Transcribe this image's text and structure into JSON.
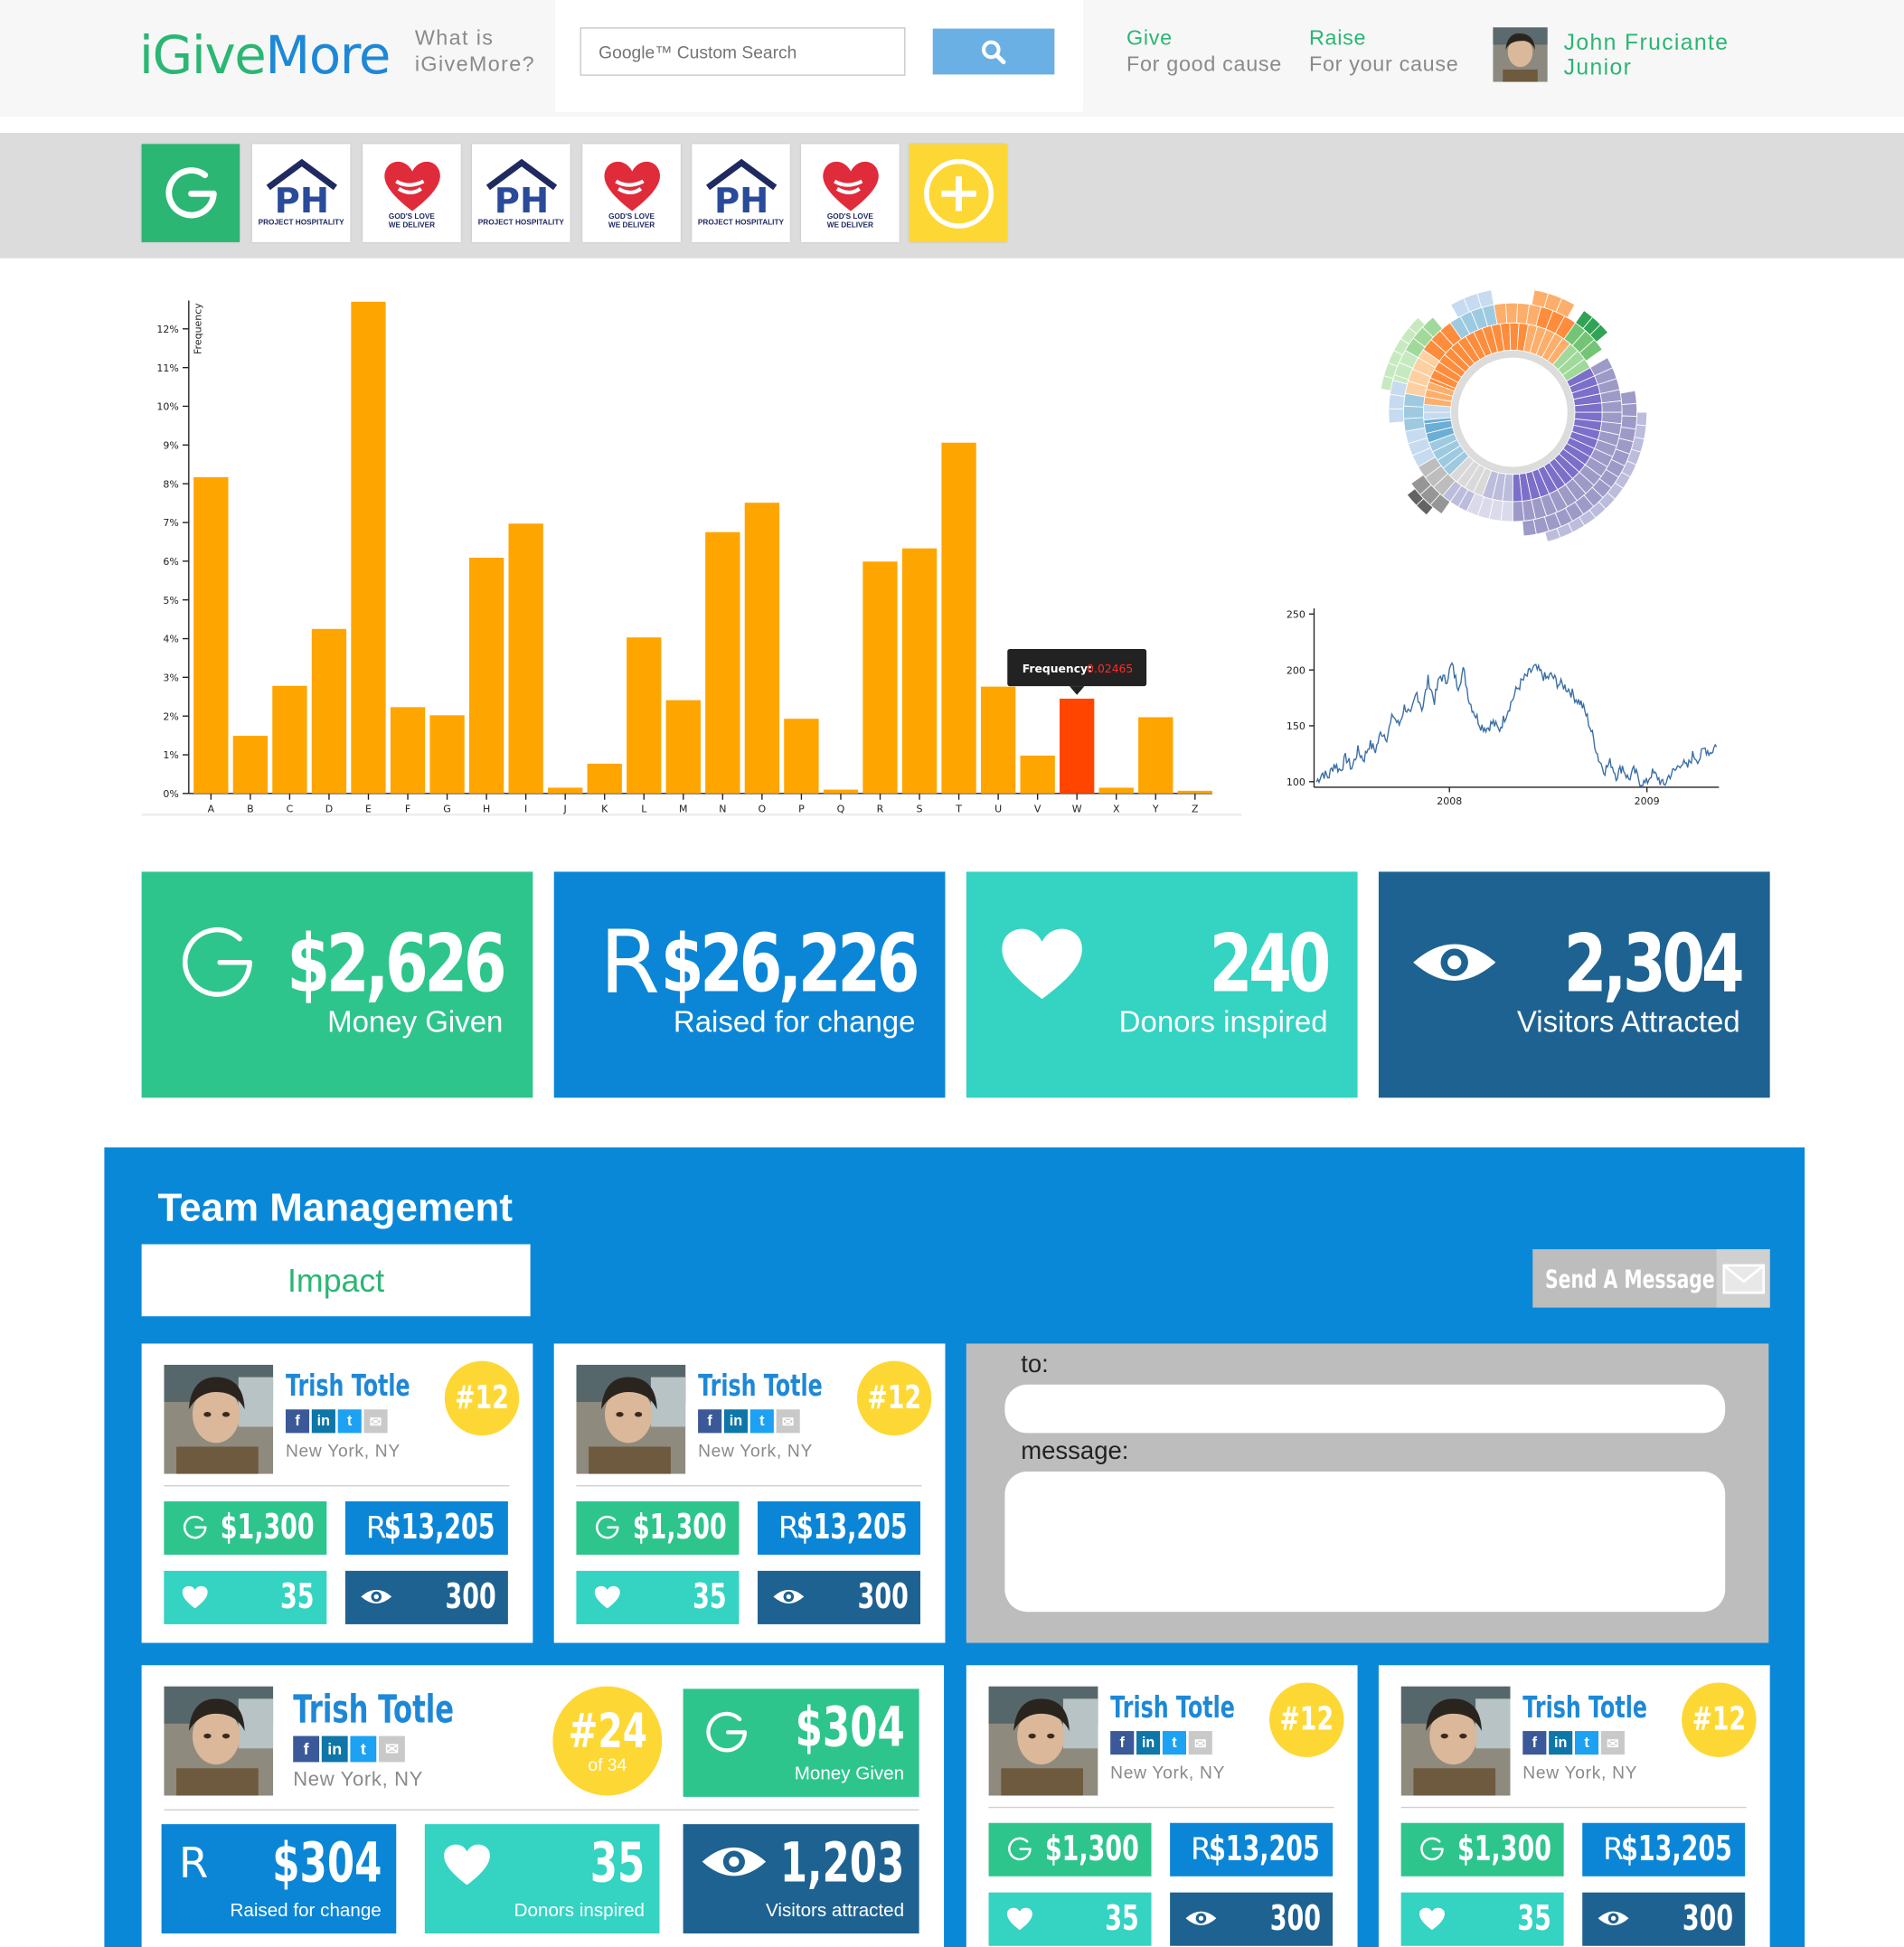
{
  "header": {
    "logo": {
      "i": "i",
      "give": "Give",
      "more": "More"
    },
    "what_line1": "What is",
    "what_line2": "iGiveMore?",
    "search_placeholder": "Google™ Custom Search",
    "search_icon": "search-icon",
    "give": {
      "title": "Give",
      "sub": "For good cause"
    },
    "raise": {
      "title": "Raise",
      "sub": "For your cause"
    },
    "user": {
      "first": "John Fruciante",
      "last": "Junior"
    }
  },
  "causes": [
    {
      "type": "g-logo"
    },
    {
      "type": "project-hospitality",
      "caption": "PROJECT HOSPITALITY",
      "mono": "PH"
    },
    {
      "type": "gods-love",
      "caption1": "GOD'S LOVE",
      "caption2": "WE DELIVER"
    },
    {
      "type": "project-hospitality",
      "caption": "PROJECT HOSPITALITY",
      "mono": "PH"
    },
    {
      "type": "gods-love",
      "caption1": "GOD'S LOVE",
      "caption2": "WE DELIVER"
    },
    {
      "type": "project-hospitality",
      "caption": "PROJECT HOSPITALITY",
      "mono": "PH"
    },
    {
      "type": "gods-love",
      "caption1": "GOD'S LOVE",
      "caption2": "WE DELIVER"
    },
    {
      "type": "add"
    }
  ],
  "chart_data": [
    {
      "type": "bar",
      "ylabel": "Frequency",
      "ylim": [
        0,
        0.127
      ],
      "yticks": [
        "0%",
        "1%",
        "2%",
        "3%",
        "4%",
        "5%",
        "6%",
        "7%",
        "8%",
        "9%",
        "10%",
        "11%",
        "12%"
      ],
      "categories": [
        "A",
        "B",
        "C",
        "D",
        "E",
        "F",
        "G",
        "H",
        "I",
        "J",
        "K",
        "L",
        "M",
        "N",
        "O",
        "P",
        "Q",
        "R",
        "S",
        "T",
        "U",
        "V",
        "W",
        "X",
        "Y",
        "Z"
      ],
      "values": [
        0.0817,
        0.0149,
        0.0278,
        0.0425,
        0.127,
        0.0223,
        0.0202,
        0.0609,
        0.0697,
        0.0015,
        0.0077,
        0.0403,
        0.0241,
        0.0675,
        0.0751,
        0.0193,
        0.001,
        0.0599,
        0.0633,
        0.0906,
        0.0276,
        0.0098,
        0.0245,
        0.0015,
        0.0197,
        0.0007
      ],
      "highlight": "W",
      "tooltip": {
        "label": "Frequency:",
        "value": "0.02465"
      },
      "colors": {
        "bar": "#ffa500",
        "highlight": "#ff4500"
      }
    },
    {
      "type": "line",
      "yticks": [
        "100",
        "150",
        "200",
        "250"
      ],
      "ylim": [
        95,
        255
      ],
      "xticks": [
        "2008",
        "2009"
      ],
      "values": [
        100,
        108,
        104,
        116,
        110,
        122,
        112,
        128,
        120,
        134,
        128,
        145,
        140,
        160,
        150,
        168,
        158,
        180,
        165,
        192,
        172,
        195,
        190,
        205,
        185,
        200,
        172,
        160,
        150,
        148,
        153,
        146,
        158,
        170,
        182,
        190,
        196,
        202,
        198,
        192,
        195,
        188,
        186,
        182,
        175,
        170,
        158,
        140,
        120,
        110,
        118,
        105,
        114,
        102,
        110,
        100,
        98,
        108,
        104,
        96,
        106,
        110,
        118,
        112,
        124,
        120,
        130,
        126,
        134
      ]
    }
  ],
  "sunburst": {
    "inner_grey": "#dcdcdc",
    "rings": [
      {
        "r1": 50,
        "r2": 72,
        "slices": [
          [
            -85,
            -38,
            "#fd8d3c"
          ],
          [
            -38,
            10,
            "#fd8d3c"
          ],
          [
            10,
            40,
            "#fdae6b"
          ],
          [
            40,
            60,
            "#a1d99b"
          ],
          [
            60,
            180,
            "#7b6fc9"
          ],
          [
            180,
            200,
            "#bcbddc"
          ],
          [
            200,
            225,
            "#d9d9d9"
          ],
          [
            225,
            250,
            "#9ecae1"
          ],
          [
            250,
            275,
            "#6baed6"
          ],
          [
            275,
            290,
            "#fdae6b"
          ],
          [
            -95,
            -85,
            "#c6dbef"
          ]
        ]
      },
      {
        "r1": 72,
        "r2": 88,
        "slices": [
          [
            -90,
            -75,
            "#a1d99b"
          ],
          [
            -75,
            -55,
            "#fdd0a2"
          ],
          [
            -55,
            -35,
            "#fd8d3c"
          ],
          [
            -35,
            -10,
            "#9ecae1"
          ],
          [
            -10,
            15,
            "#fdae6b"
          ],
          [
            15,
            35,
            "#fd8d3c"
          ],
          [
            35,
            55,
            "#74c476"
          ],
          [
            60,
            180,
            "#9e9ac8"
          ],
          [
            180,
            205,
            "#dadaeb"
          ],
          [
            205,
            220,
            "#bcbddc"
          ],
          [
            220,
            240,
            "#bdbdbd"
          ],
          [
            240,
            260,
            "#c6dbef"
          ],
          [
            260,
            280,
            "#9ecae1"
          ],
          [
            280,
            300,
            "#fdd0a2"
          ]
        ]
      },
      {
        "r1": 88,
        "r2": 100,
        "slices": [
          [
            -85,
            -60,
            "#c7e9c0"
          ],
          [
            -60,
            -40,
            "#a1d99b"
          ],
          [
            -30,
            -10,
            "#c6dbef"
          ],
          [
            10,
            30,
            "#fdae6b"
          ],
          [
            35,
            50,
            "#31a354"
          ],
          [
            80,
            175,
            "#9e9ac8"
          ],
          [
            215,
            235,
            "#969696"
          ],
          [
            265,
            285,
            "#c6dbef"
          ]
        ]
      },
      {
        "r1": 100,
        "r2": 108,
        "slices": [
          [
            -80,
            -45,
            "#c7e9c0"
          ],
          [
            90,
            165,
            "#bcbddc"
          ],
          [
            220,
            232,
            "#636363"
          ]
        ]
      }
    ]
  },
  "stats": [
    {
      "value": "$2,626",
      "label": "Money Given",
      "color": "#2ec58d",
      "icon": "g-icon"
    },
    {
      "value": "$26,226",
      "label": "Raised for change",
      "color": "#0b86d6",
      "icon": "r-icon"
    },
    {
      "value": "240",
      "label": "Donors inspired",
      "color": "#34d3c2",
      "icon": "heart-icon"
    },
    {
      "value": "2,304",
      "label": "Visitors Attracted",
      "color": "#1e6291",
      "icon": "eye-icon"
    }
  ],
  "team": {
    "title": "Team Management",
    "tab": "Impact",
    "send_label": "Send A Message",
    "to_label": "to:",
    "message_label": "message:",
    "member": {
      "name": "Trish Totle",
      "location": "New York, NY",
      "rank": "#12",
      "given": "$1,300",
      "raised": "$13,205",
      "donors": "35",
      "visitors": "300"
    },
    "featured": {
      "name": "Trish Totle",
      "location": "New York, NY",
      "rank": "#24",
      "rank_of": "of 34",
      "given": "$304",
      "given_label": "Money Given",
      "raised": "$304",
      "raised_label": "Raised for change",
      "donors": "35",
      "donors_label": "Donors inspired",
      "visitors": "1,203",
      "visitors_label": "Visitors attracted"
    },
    "r_letter": "R"
  }
}
